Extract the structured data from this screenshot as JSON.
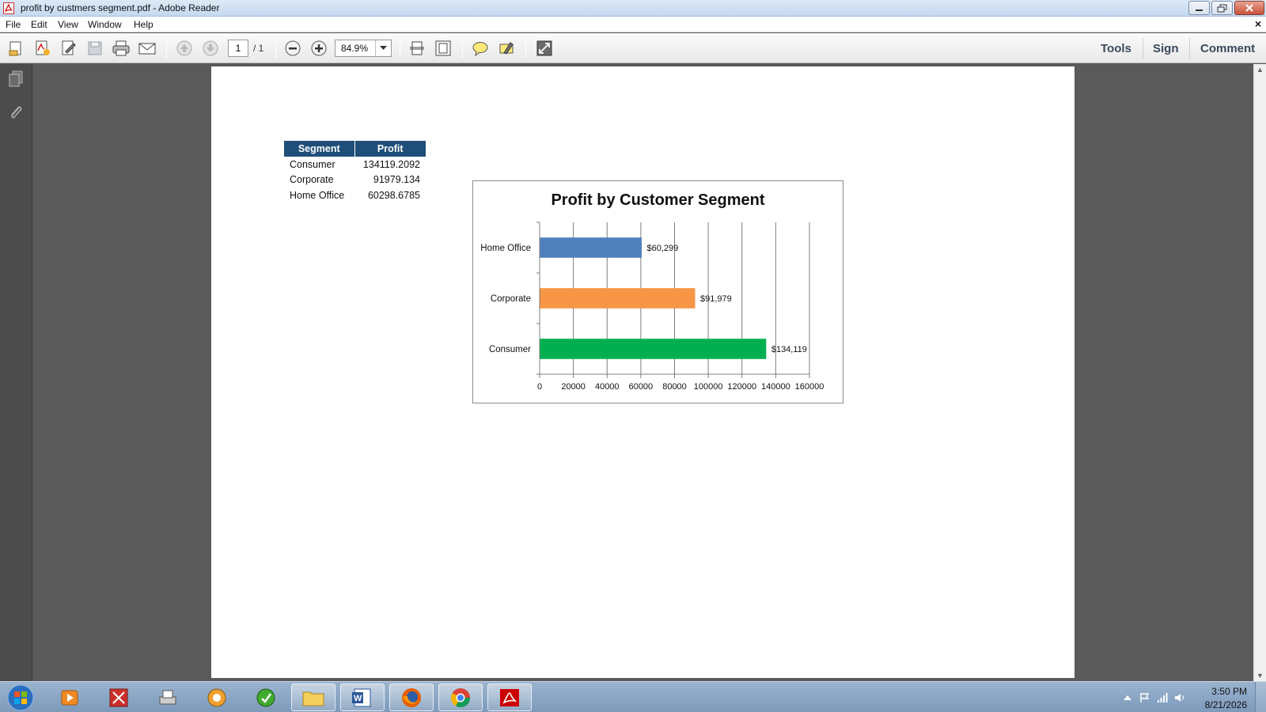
{
  "window": {
    "title": "profit by custmers segment.pdf - Adobe Reader"
  },
  "menu": {
    "items": [
      "File",
      "Edit",
      "View",
      "Window",
      "Help"
    ]
  },
  "toolbar": {
    "page_current": "1",
    "page_total": "/ 1",
    "zoom": "84.9%",
    "right_tools": [
      "Tools",
      "Sign",
      "Comment"
    ]
  },
  "document": {
    "table": {
      "headers": [
        "Segment",
        "Profit"
      ],
      "rows": [
        [
          "Consumer",
          "134119.2092"
        ],
        [
          "Corporate",
          "91979.134"
        ],
        [
          "Home Office",
          "60298.6785"
        ]
      ]
    }
  },
  "chart_data": {
    "type": "bar",
    "orientation": "horizontal",
    "title": "Profit by Customer Segment",
    "categories": [
      "Home Office",
      "Corporate",
      "Consumer"
    ],
    "values": [
      60298.6785,
      91979.134,
      134119.2092
    ],
    "data_labels": [
      "$60,299",
      "$91,979",
      "$134,119"
    ],
    "colors": [
      "#4f81bd",
      "#f79646",
      "#00b050"
    ],
    "xlim": [
      0,
      160000
    ],
    "xticks": [
      0,
      20000,
      40000,
      60000,
      80000,
      100000,
      120000,
      140000,
      160000
    ],
    "xtick_labels": [
      "0",
      "20000",
      "40000",
      "60000",
      "80000",
      "100000",
      "120000",
      "140000",
      "160000"
    ],
    "grid": true,
    "legend": "none"
  },
  "taskbar": {
    "time": "3:50 PM",
    "date": "8/21/2026"
  },
  "icons": {
    "open": "open-file-icon",
    "create": "create-pdf-icon",
    "edit": "edit-icon",
    "save": "save-icon",
    "print": "print-icon",
    "email": "email-icon",
    "prev": "previous-page-icon",
    "next": "next-page-icon",
    "zoom_out": "zoom-out-icon",
    "zoom_in": "zoom-in-icon",
    "fit_width": "fit-width-icon",
    "fit_page": "fit-page-icon",
    "comment": "sticky-note-icon",
    "highlight": "highlight-icon",
    "read_mode": "read-mode-icon"
  }
}
